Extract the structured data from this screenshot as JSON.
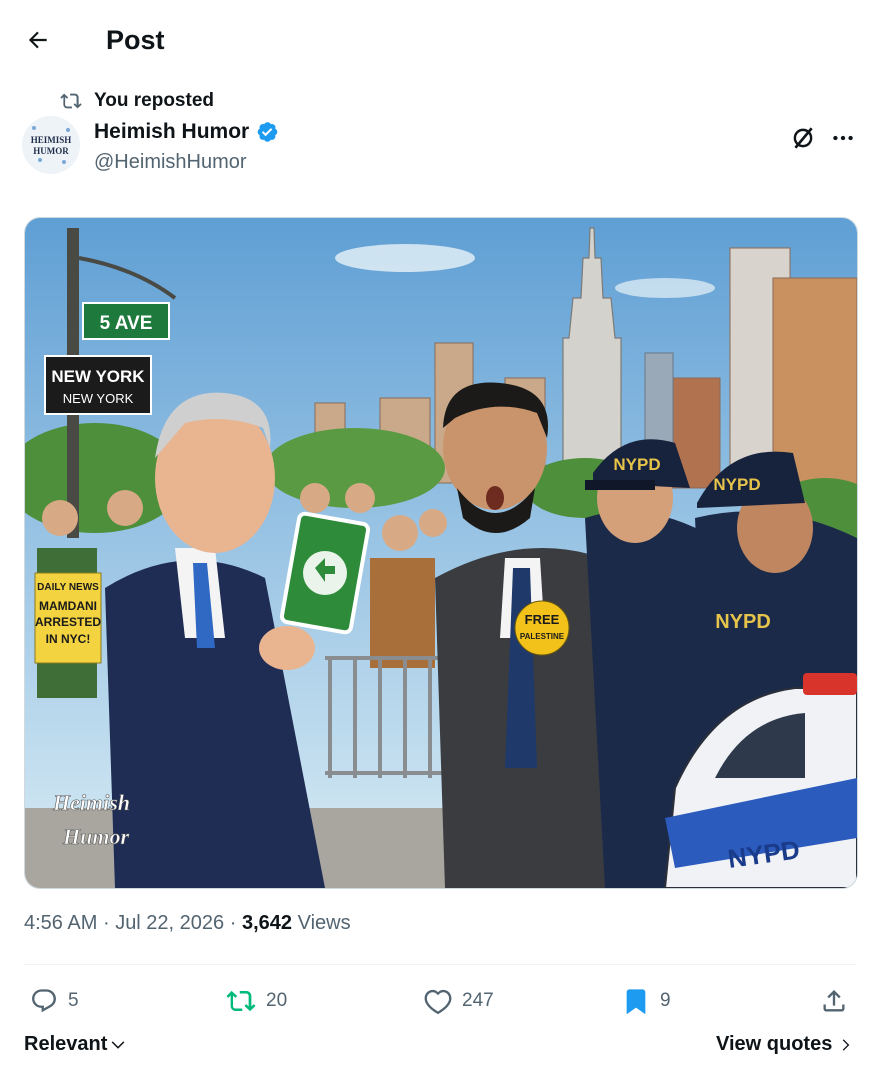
{
  "header": {
    "title": "Post",
    "back_icon": "arrow-left-icon"
  },
  "repost": {
    "label": "You reposted",
    "icon": "repost-icon"
  },
  "author": {
    "name": "Heimish Humor",
    "handle": "@HeimishHumor",
    "verified": true,
    "verified_color": "#1d9bf0",
    "avatar_text_top": "HEIMISH",
    "avatar_text_bottom": "HUMOR"
  },
  "post_image": {
    "street_sign": "5 AVE",
    "city_sign_top": "NEW YORK",
    "city_sign_bottom": "NEW YORK",
    "newspaper_header": "DAILY NEWS",
    "newspaper_headline_1": "MAMDANI",
    "newspaper_headline_2": "ARRESTED",
    "newspaper_headline_3": "IN NYC!",
    "badge_line_1": "FREE",
    "badge_line_2": "PALESTINE",
    "cap_1": "NYPD",
    "cap_2": "NYPD",
    "uniform_text": "NYPD",
    "car_text": "NYPD",
    "watermark_1": "Heimish",
    "watermark_2": "Humor"
  },
  "meta": {
    "time": "4:56 AM",
    "separator": "·",
    "date": "Jul 22, 2026",
    "views_count": "3,642",
    "views_label": "Views"
  },
  "actions": {
    "replies": "5",
    "reposts": "20",
    "likes": "247",
    "bookmarks": "9",
    "repost_color": "#00ba7c",
    "bookmark_color": "#1d9bf0"
  },
  "footer": {
    "sort_label": "Relevant",
    "view_quotes_label": "View quotes"
  }
}
